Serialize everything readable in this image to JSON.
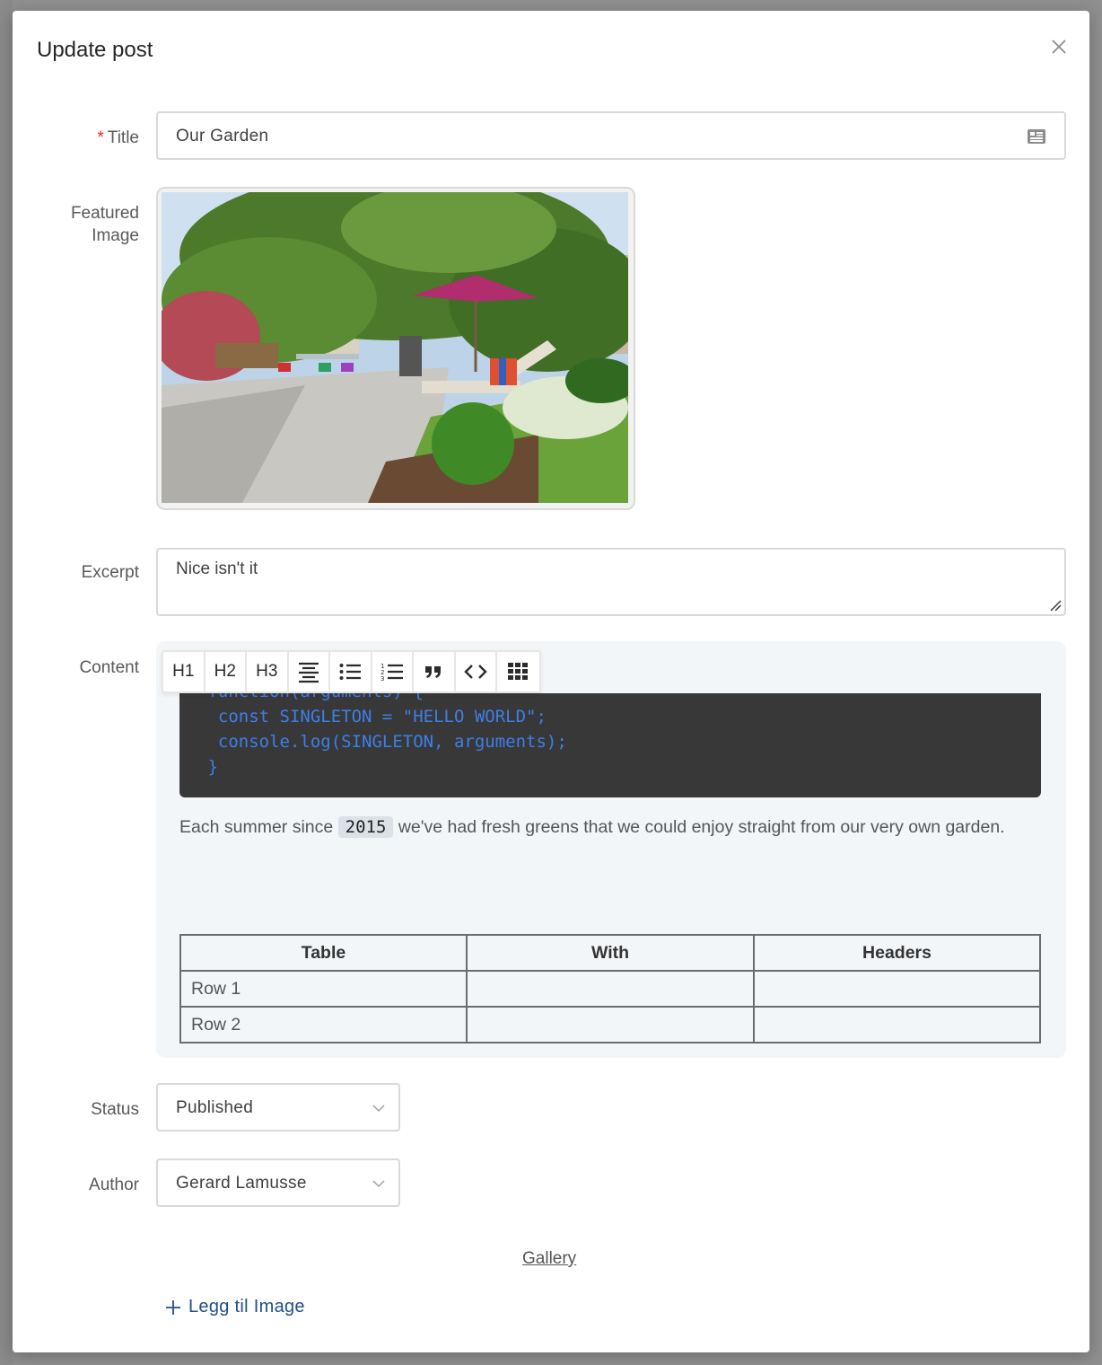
{
  "modal": {
    "title": "Update post"
  },
  "form": {
    "title_label": "Title",
    "title_required_mark": "*",
    "title_value": "Our Garden",
    "featured_image_label_line1": "Featured",
    "featured_image_label_line2": "Image",
    "excerpt_label": "Excerpt",
    "excerpt_value": "Nice isn't it",
    "content_label": "Content",
    "status_label": "Status",
    "status_value": "Published",
    "author_label": "Author",
    "author_value": "Gerard Lamusse"
  },
  "toolbar": {
    "buttons": [
      {
        "label": "H1",
        "icon": "heading-1"
      },
      {
        "label": "H2",
        "icon": "heading-2"
      },
      {
        "label": "H3",
        "icon": "heading-3"
      },
      {
        "label": "",
        "icon": "align-center-icon"
      },
      {
        "label": "",
        "icon": "bullet-list-icon"
      },
      {
        "label": "",
        "icon": "numbered-list-icon"
      },
      {
        "label": "",
        "icon": "quote-icon"
      },
      {
        "label": "",
        "icon": "code-icon"
      },
      {
        "label": "",
        "icon": "table-grid-icon"
      }
    ]
  },
  "content": {
    "code_lines": [
      " function(arguments) {",
      "  const SINGLETON = \"HELLO WORLD\";",
      "  console.log(SINGLETON, arguments);",
      " }"
    ],
    "paragraph_before": "Each summer since ",
    "paragraph_code": "2015",
    "paragraph_after": " we've had fresh greens that we could enjoy straight from our very own garden.",
    "table": {
      "headers": [
        "Table",
        "With",
        "Headers"
      ],
      "rows": [
        [
          "Row 1",
          "",
          ""
        ],
        [
          "Row 2",
          "",
          ""
        ]
      ]
    }
  },
  "footer": {
    "gallery_link": "Gallery",
    "add_image_label": "Legg til Image"
  },
  "colors": {
    "accent": "#1f4e8c",
    "required": "#f5222d",
    "code_bg": "#383838",
    "code_text": "#3d7fe8"
  }
}
